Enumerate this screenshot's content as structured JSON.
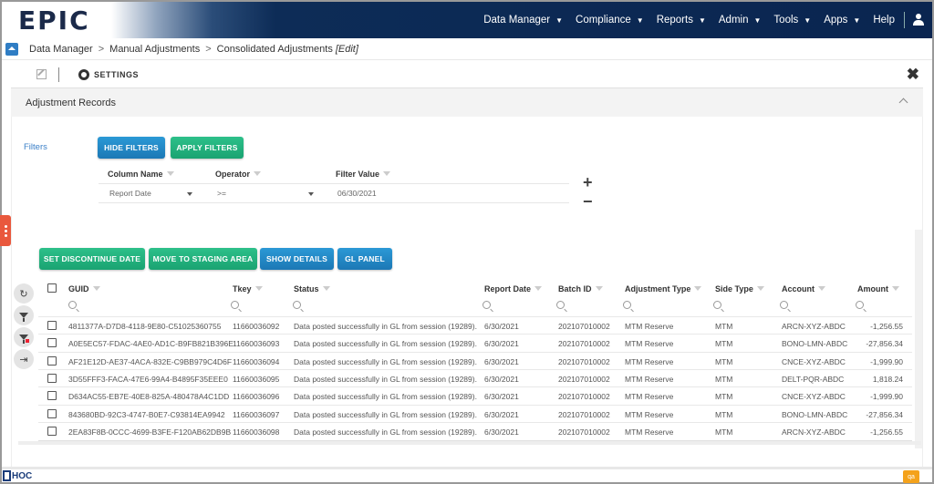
{
  "header": {
    "logo_text": "EPIC",
    "nav": [
      {
        "label": "Data Manager",
        "has_dropdown": true
      },
      {
        "label": "Compliance",
        "has_dropdown": true
      },
      {
        "label": "Reports",
        "has_dropdown": true
      },
      {
        "label": "Admin",
        "has_dropdown": true
      },
      {
        "label": "Tools",
        "has_dropdown": true
      },
      {
        "label": "Apps",
        "has_dropdown": true
      },
      {
        "label": "Help",
        "has_dropdown": false
      }
    ],
    "user_icon": "user-icon"
  },
  "breadcrumb": {
    "items": [
      "Data Manager",
      "Manual Adjustments",
      "Consolidated Adjustments"
    ],
    "separator": ">",
    "mode": "[Edit]"
  },
  "toolbar": {
    "settings_label": "SETTINGS",
    "close_icon": "close-icon"
  },
  "panel": {
    "title": "Adjustment Records"
  },
  "filters": {
    "label": "Filters",
    "hide_button": "HIDE FILTERS",
    "apply_button": "APPLY FILTERS",
    "headers": [
      "Column Name",
      "Operator",
      "Filter Value"
    ],
    "rows": [
      {
        "column": "Report Date",
        "operator": ">=",
        "value": "06/30/2021"
      }
    ],
    "add_icon": "+",
    "remove_icon": "−"
  },
  "actions": {
    "set_discontinue": "SET DISCONTINUE DATE",
    "move_staging": "MOVE TO STAGING AREA",
    "show_details": "SHOW DETAILS",
    "gl_panel": "GL PANEL"
  },
  "grid": {
    "columns": [
      "GUID",
      "Tkey",
      "Status",
      "Report Date",
      "Batch ID",
      "Adjustment Type",
      "Side Type",
      "Account",
      "Amount"
    ],
    "rows": [
      {
        "guid": "4811377A-D7D8-4118-9E80-C51025360755",
        "tkey": "11660036092",
        "status": "Data posted successfully in GL from session (19289).",
        "report_date": "6/30/2021",
        "batch_id": "202107010002",
        "adj_type": "MTM Reserve",
        "side_type": "MTM",
        "account": "ARCN-XYZ-ABDC",
        "amount": "-1,256.55"
      },
      {
        "guid": "A0E5EC57-FDAC-4AE0-AD1C-B9FB821B396E",
        "tkey": "11660036093",
        "status": "Data posted successfully in GL from session (19289).",
        "report_date": "6/30/2021",
        "batch_id": "202107010002",
        "adj_type": "MTM Reserve",
        "side_type": "MTM",
        "account": "BONO-LMN-ABDC",
        "amount": "-27,856.34"
      },
      {
        "guid": "AF21E12D-AE37-4ACA-832E-C9BB979C4D6F",
        "tkey": "11660036094",
        "status": "Data posted successfully in GL from session (19289).",
        "report_date": "6/30/2021",
        "batch_id": "202107010002",
        "adj_type": "MTM Reserve",
        "side_type": "MTM",
        "account": "CNCE-XYZ-ABDC",
        "amount": "-1,999.90"
      },
      {
        "guid": "3D55FFF3-FACA-47E6-99A4-B4895F35EEE0",
        "tkey": "11660036095",
        "status": "Data posted successfully in GL from session (19289).",
        "report_date": "6/30/2021",
        "batch_id": "202107010002",
        "adj_type": "MTM Reserve",
        "side_type": "MTM",
        "account": "DELT-PQR-ABDC",
        "amount": "1,818.24"
      },
      {
        "guid": "D634AC55-EB7E-40E8-825A-480478A4C1DD",
        "tkey": "11660036096",
        "status": "Data posted successfully in GL from session (19289).",
        "report_date": "6/30/2021",
        "batch_id": "202107010002",
        "adj_type": "MTM Reserve",
        "side_type": "MTM",
        "account": "CNCE-XYZ-ABDC",
        "amount": "-1,999.90"
      },
      {
        "guid": "843680BD-92C3-4747-B0E7-C93814EA9942",
        "tkey": "11660036097",
        "status": "Data posted successfully in GL from session (19289).",
        "report_date": "6/30/2021",
        "batch_id": "202107010002",
        "adj_type": "MTM Reserve",
        "side_type": "MTM",
        "account": "BONO-LMN-ABDC",
        "amount": "-27,856.34"
      },
      {
        "guid": "2EA83F8B-0CCC-4699-B3FE-F120AB62DB9B",
        "tkey": "11660036098",
        "status": "Data posted successfully in GL from session (19289).",
        "report_date": "6/30/2021",
        "batch_id": "202107010002",
        "adj_type": "MTM Reserve",
        "side_type": "MTM",
        "account": "ARCN-XYZ-ABDC",
        "amount": "-1,256.55"
      }
    ]
  },
  "footer": {
    "logo_text": "HOC",
    "env_badge": "qa"
  },
  "colors": {
    "nav_bg": "#0a2550",
    "primary_blue": "#1c78b5",
    "success_green": "#1aa372",
    "side_tab": "#e9583d",
    "env_badge": "#f4a21b"
  }
}
